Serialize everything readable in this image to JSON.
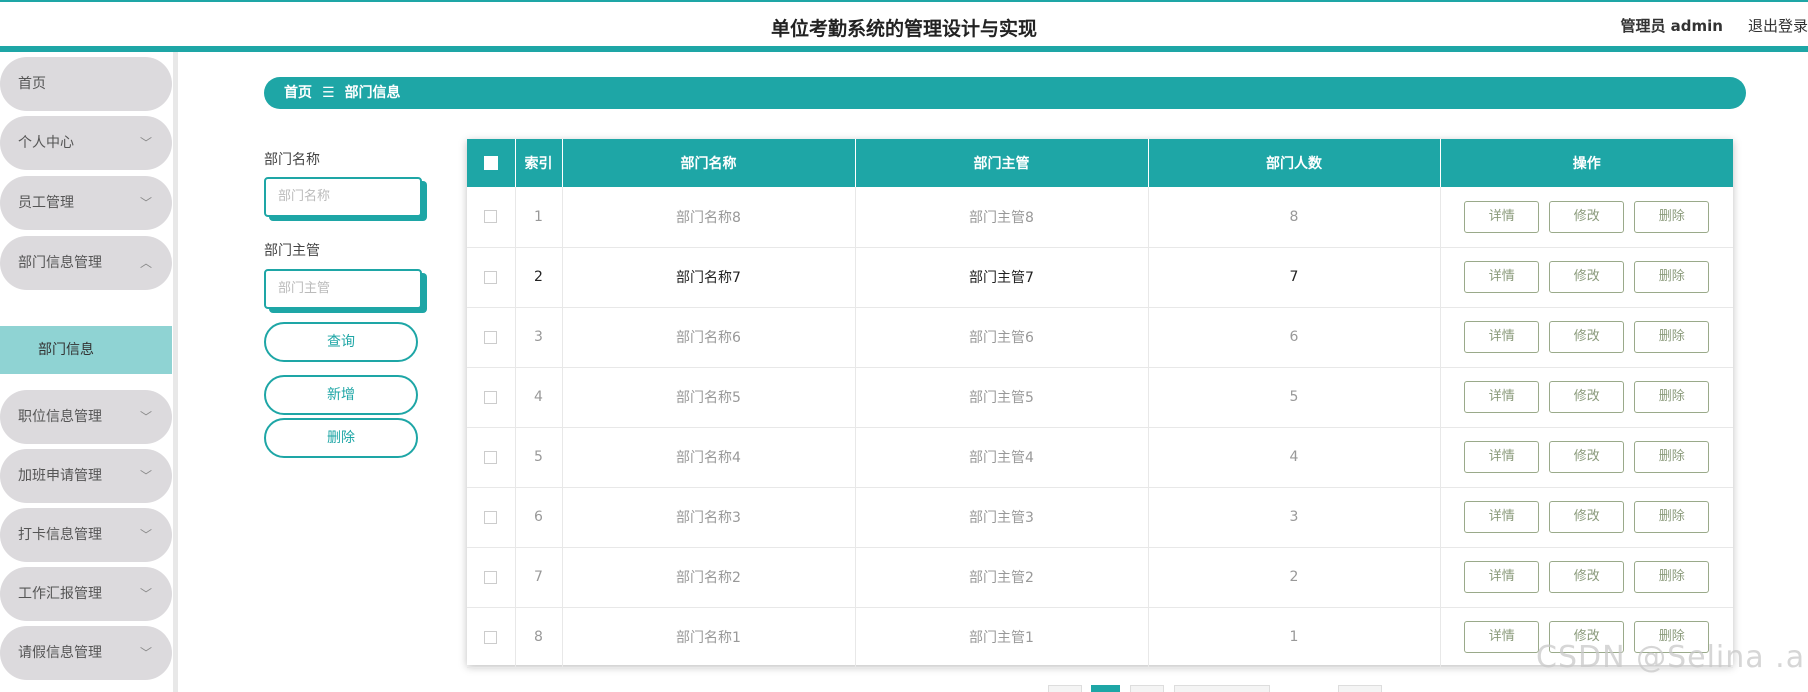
{
  "header": {
    "title": "单位考勤系统的管理设计与实现",
    "admin_label": "管理员 admin",
    "logout_label": "退出登录"
  },
  "sidebar": {
    "items": [
      {
        "label": "首页",
        "arrow": ""
      },
      {
        "label": "个人中心",
        "arrow": "﹀"
      },
      {
        "label": "员工管理",
        "arrow": "﹀"
      },
      {
        "label": "部门信息管理",
        "arrow": "︿"
      },
      {
        "label": "职位信息管理",
        "arrow": "﹀"
      },
      {
        "label": "加班申请管理",
        "arrow": "﹀"
      },
      {
        "label": "打卡信息管理",
        "arrow": "﹀"
      },
      {
        "label": "工作汇报管理",
        "arrow": "﹀"
      },
      {
        "label": "请假信息管理",
        "arrow": "﹀"
      }
    ],
    "submenu": {
      "label": "部门信息"
    }
  },
  "breadcrumb": {
    "home": "首页",
    "separator": "☰",
    "current": "部门信息"
  },
  "search": {
    "name_label": "部门名称",
    "name_placeholder": "部门名称",
    "manager_label": "部门主管",
    "manager_placeholder": "部门主管",
    "query_button": "查询",
    "add_button": "新增",
    "delete_button": "删除"
  },
  "table": {
    "headers": {
      "index": "索引",
      "name": "部门名称",
      "manager": "部门主管",
      "count": "部门人数",
      "ops": "操作"
    },
    "buttons": {
      "detail": "详情",
      "edit": "修改",
      "delete": "删除"
    },
    "rows": [
      {
        "index": "1",
        "name": "部门名称8",
        "manager": "部门主管8",
        "count": "8"
      },
      {
        "index": "2",
        "name": "部门名称7",
        "manager": "部门主管7",
        "count": "7"
      },
      {
        "index": "3",
        "name": "部门名称6",
        "manager": "部门主管6",
        "count": "6"
      },
      {
        "index": "4",
        "name": "部门名称5",
        "manager": "部门主管5",
        "count": "5"
      },
      {
        "index": "5",
        "name": "部门名称4",
        "manager": "部门主管4",
        "count": "4"
      },
      {
        "index": "6",
        "name": "部门名称3",
        "manager": "部门主管3",
        "count": "3"
      },
      {
        "index": "7",
        "name": "部门名称2",
        "manager": "部门主管2",
        "count": "2"
      },
      {
        "index": "8",
        "name": "部门名称1",
        "manager": "部门主管1",
        "count": "1"
      }
    ]
  },
  "watermark": "CSDN @Selina .a",
  "colors": {
    "accent": "#1ea6a6",
    "submenu_active": "#8fd3d3",
    "menu_bg": "#dcdadd"
  }
}
